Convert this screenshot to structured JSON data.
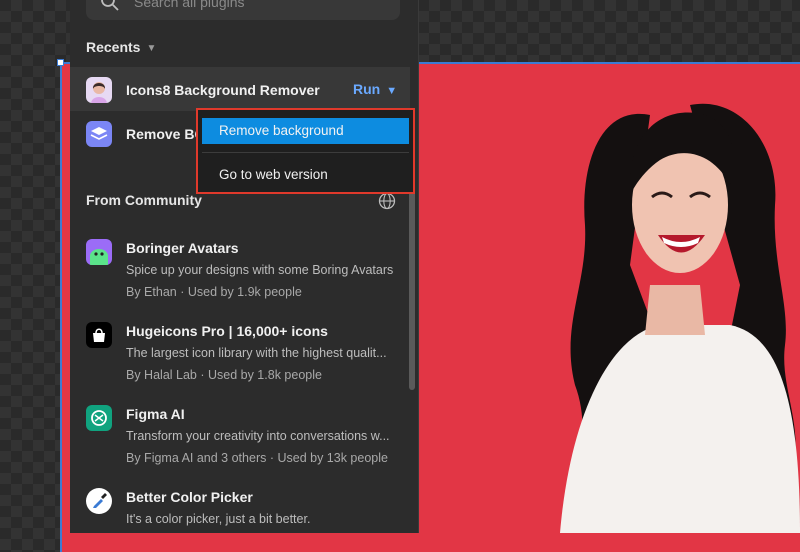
{
  "search": {
    "placeholder": "Search all plugins",
    "icon": "search-icon"
  },
  "recents": {
    "title": "Recents",
    "items": [
      {
        "name": "Icons8 Background Remover",
        "action": "Run",
        "icon": "avatar-photo-icon"
      },
      {
        "name": "Remove BG",
        "icon": "layers-icon"
      }
    ]
  },
  "dropdown": {
    "items": [
      "Remove background",
      "Go to web version"
    ]
  },
  "community": {
    "title": "From Community",
    "icon": "globe-icon",
    "items": [
      {
        "name": "Boringer Avatars",
        "desc": "Spice up your designs with some Boring Avatars",
        "meta": "By Ethan · Used by 1.9k people",
        "color": "#8a5cf6"
      },
      {
        "name": "Hugeicons Pro | 16,000+ icons",
        "desc": "The largest icon library with the highest qualit...",
        "meta": "By Halal Lab · Used by 1.8k people",
        "color": "#000000"
      },
      {
        "name": "Figma AI",
        "desc": "Transform your creativity into conversations w...",
        "meta": "By Figma AI and 3 others · Used by 13k people",
        "color": "#10a37f"
      },
      {
        "name": "Better Color Picker",
        "desc": "It's a color picker, just a bit better.",
        "meta": "",
        "color": "#ffffff"
      }
    ]
  },
  "colors": {
    "accent": "#0d8ce0",
    "run": "#6aa9ff",
    "highlight_border": "#e0392b",
    "canvas_bg": "#e23645"
  }
}
